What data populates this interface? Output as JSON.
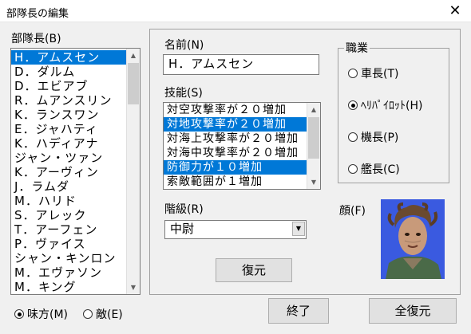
{
  "window": {
    "title": "部隊長の編集",
    "close_glyph": "✕"
  },
  "commander_list": {
    "label": "部隊長(B)",
    "items": [
      "H．アムスセン",
      "D．ダルム",
      "D．エビアブ",
      "R．ムアンスリン",
      "K．ランスワン",
      "E．ジャハティ",
      "K．ハディアナ",
      "ジャン・ツァン",
      "K．アーヴィン",
      "J．ラムダ",
      "M．ハリド",
      "S．アレック",
      "T．アーフェン",
      "P．ヴァイス",
      "シャン・キンロン",
      "M．エヴァソン",
      "M．キング"
    ],
    "selected_index": 0
  },
  "name_field": {
    "label": "名前(N)",
    "value": "H．アムスセン"
  },
  "skills": {
    "label": "技能(S)",
    "items": [
      {
        "text": "対空攻撃率が２０増加",
        "selected": false
      },
      {
        "text": "対地攻撃率が２０増加",
        "selected": true
      },
      {
        "text": "対海上攻撃率が２０増加",
        "selected": false
      },
      {
        "text": "対海中攻撃率が２０増加",
        "selected": false
      },
      {
        "text": "防御力が１０増加",
        "selected": true
      },
      {
        "text": "索敵範囲が１増加",
        "selected": false
      }
    ]
  },
  "rank": {
    "label": "階級(R)",
    "value": "中尉"
  },
  "restore_button": "復元",
  "occupation": {
    "label": "職業",
    "options": [
      {
        "label": "車長(T)",
        "checked": false
      },
      {
        "label": "ﾍﾘﾊﾟｲﾛｯﾄ(H)",
        "checked": true
      },
      {
        "label": "機長(P)",
        "checked": false
      },
      {
        "label": "艦長(C)",
        "checked": false
      }
    ]
  },
  "face": {
    "label": "顔(F)"
  },
  "faction": {
    "options": [
      {
        "label": "味方(M)",
        "checked": true
      },
      {
        "label": "敵(E)",
        "checked": false
      }
    ]
  },
  "buttons": {
    "end": "終了",
    "restore_all": "全復元"
  }
}
